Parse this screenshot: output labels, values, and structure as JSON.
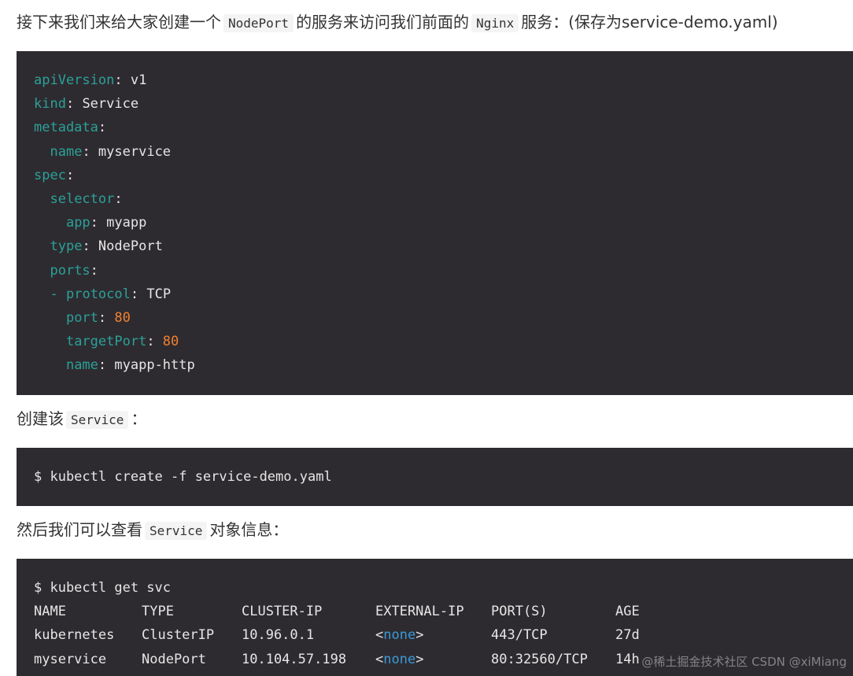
{
  "intro": {
    "before": "接下来我们来给大家创建一个",
    "code1": "NodePort",
    "middle": "的服务来访问我们前面的",
    "code2": "Nginx",
    "after": "服务：(保存为service-demo.yaml)"
  },
  "yaml": {
    "l1k": "apiVersion",
    "l1v": "v1",
    "l2k": "kind",
    "l2v": "Service",
    "l3k": "metadata",
    "l4k": "name",
    "l4v": "myservice",
    "l5k": "spec",
    "l6k": "selector",
    "l7k": "app",
    "l7v": "myapp",
    "l8k": "type",
    "l8v": "NodePort",
    "l9k": "ports",
    "l10k": "protocol",
    "l10v": "TCP",
    "l11k": "port",
    "l11v": "80",
    "l12k": "targetPort",
    "l12v": "80",
    "l13k": "name",
    "l13v": "myapp-http"
  },
  "create": {
    "before": "创建该",
    "code": "Service",
    "after": "："
  },
  "cmd1": "$ kubectl create -f service-demo.yaml",
  "view": {
    "before": "然后我们可以查看",
    "code": "Service",
    "after": "对象信息："
  },
  "cmd2": "$ kubectl get svc",
  "table": {
    "headers": [
      "NAME",
      "TYPE",
      "CLUSTER-IP",
      "EXTERNAL-IP",
      "PORT(S)",
      "AGE"
    ],
    "rows": [
      {
        "name": "kubernetes",
        "type": "ClusterIP",
        "ip": "10.96.0.1",
        "ext": "none",
        "ports": "443/TCP",
        "age": "27d"
      },
      {
        "name": "myservice",
        "type": "NodePort",
        "ip": "10.104.57.198",
        "ext": "none",
        "ports": "80:32560/TCP",
        "age": "14h"
      }
    ]
  },
  "watermark": "@稀土掘金技术社区 CSDN @xiMiang"
}
